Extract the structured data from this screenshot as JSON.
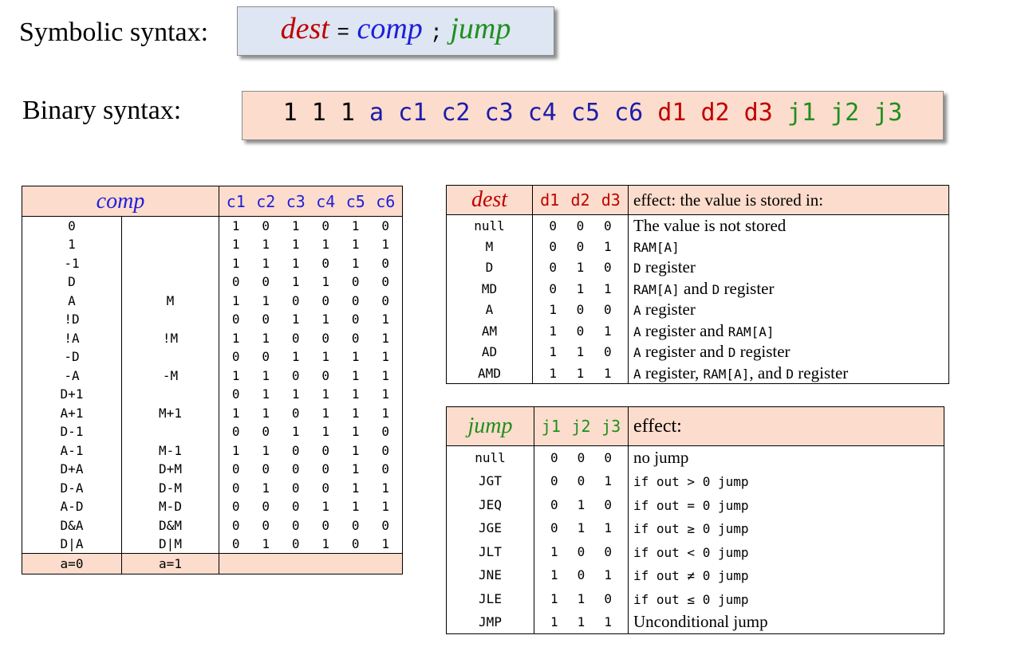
{
  "colors": {
    "dest": "#c00000",
    "comp": "#1f1fdb",
    "jump": "#1f8f1f",
    "a": "#1c1caa",
    "header_bg": "#fcdccc",
    "symbolic_bg": "#dde6f2"
  },
  "symbolic": {
    "label": "Symbolic syntax:",
    "dest": "dest",
    "eq": "=",
    "comp": "comp",
    "semi": ";",
    "jump": "jump"
  },
  "binary": {
    "label": "Binary syntax:",
    "ones": "1 1 1",
    "a": "a",
    "c": "c1 c2 c3 c4 c5 c6",
    "d": "d1 d2 d3",
    "j": "j1 j2 j3"
  },
  "comp_table": {
    "header": "comp",
    "bit_header": [
      "c1",
      "c2",
      "c3",
      "c4",
      "c5",
      "c6"
    ],
    "rows": [
      {
        "a0": "0",
        "a1": "",
        "bits": [
          "1",
          "0",
          "1",
          "0",
          "1",
          "0"
        ]
      },
      {
        "a0": "1",
        "a1": "",
        "bits": [
          "1",
          "1",
          "1",
          "1",
          "1",
          "1"
        ]
      },
      {
        "a0": "-1",
        "a1": "",
        "bits": [
          "1",
          "1",
          "1",
          "0",
          "1",
          "0"
        ]
      },
      {
        "a0": "D",
        "a1": "",
        "bits": [
          "0",
          "0",
          "1",
          "1",
          "0",
          "0"
        ]
      },
      {
        "a0": "A",
        "a1": "M",
        "bits": [
          "1",
          "1",
          "0",
          "0",
          "0",
          "0"
        ]
      },
      {
        "a0": "!D",
        "a1": "",
        "bits": [
          "0",
          "0",
          "1",
          "1",
          "0",
          "1"
        ]
      },
      {
        "a0": "!A",
        "a1": "!M",
        "bits": [
          "1",
          "1",
          "0",
          "0",
          "0",
          "1"
        ]
      },
      {
        "a0": "-D",
        "a1": "",
        "bits": [
          "0",
          "0",
          "1",
          "1",
          "1",
          "1"
        ]
      },
      {
        "a0": "-A",
        "a1": "-M",
        "bits": [
          "1",
          "1",
          "0",
          "0",
          "1",
          "1"
        ]
      },
      {
        "a0": "D+1",
        "a1": "",
        "bits": [
          "0",
          "1",
          "1",
          "1",
          "1",
          "1"
        ]
      },
      {
        "a0": "A+1",
        "a1": "M+1",
        "bits": [
          "1",
          "1",
          "0",
          "1",
          "1",
          "1"
        ]
      },
      {
        "a0": "D-1",
        "a1": "",
        "bits": [
          "0",
          "0",
          "1",
          "1",
          "1",
          "0"
        ]
      },
      {
        "a0": "A-1",
        "a1": "M-1",
        "bits": [
          "1",
          "1",
          "0",
          "0",
          "1",
          "0"
        ]
      },
      {
        "a0": "D+A",
        "a1": "D+M",
        "bits": [
          "0",
          "0",
          "0",
          "0",
          "1",
          "0"
        ]
      },
      {
        "a0": "D-A",
        "a1": "D-M",
        "bits": [
          "0",
          "1",
          "0",
          "0",
          "1",
          "1"
        ]
      },
      {
        "a0": "A-D",
        "a1": "M-D",
        "bits": [
          "0",
          "0",
          "0",
          "1",
          "1",
          "1"
        ]
      },
      {
        "a0": "D&A",
        "a1": "D&M",
        "bits": [
          "0",
          "0",
          "0",
          "0",
          "0",
          "0"
        ]
      },
      {
        "a0": "D|A",
        "a1": "D|M",
        "bits": [
          "0",
          "1",
          "0",
          "1",
          "0",
          "1"
        ]
      }
    ],
    "footer": {
      "a0": "a=0",
      "a1": "a=1"
    }
  },
  "dest_table": {
    "header": "dest",
    "bit_header": [
      "d1",
      "d2",
      "d3"
    ],
    "effect_header": "effect: the value is stored in:",
    "rows": [
      {
        "name": "null",
        "bits": [
          "0",
          "0",
          "0"
        ],
        "effect": [
          {
            "t": "The value is not stored",
            "m": false
          }
        ]
      },
      {
        "name": "M",
        "bits": [
          "0",
          "0",
          "1"
        ],
        "effect": [
          {
            "t": "RAM[A]",
            "m": true
          }
        ]
      },
      {
        "name": "D",
        "bits": [
          "0",
          "1",
          "0"
        ],
        "effect": [
          {
            "t": "D",
            "m": true
          },
          {
            "t": " register",
            "m": false
          }
        ]
      },
      {
        "name": "MD",
        "bits": [
          "0",
          "1",
          "1"
        ],
        "effect": [
          {
            "t": "RAM[A]",
            "m": true
          },
          {
            "t": " and ",
            "m": false
          },
          {
            "t": "D",
            "m": true
          },
          {
            "t": " register",
            "m": false
          }
        ]
      },
      {
        "name": "A",
        "bits": [
          "1",
          "0",
          "0"
        ],
        "effect": [
          {
            "t": "A",
            "m": true
          },
          {
            "t": " register",
            "m": false
          }
        ]
      },
      {
        "name": "AM",
        "bits": [
          "1",
          "0",
          "1"
        ],
        "effect": [
          {
            "t": "A",
            "m": true
          },
          {
            "t": " register and ",
            "m": false
          },
          {
            "t": "RAM[A]",
            "m": true
          }
        ]
      },
      {
        "name": "AD",
        "bits": [
          "1",
          "1",
          "0"
        ],
        "effect": [
          {
            "t": "A",
            "m": true
          },
          {
            "t": " register and ",
            "m": false
          },
          {
            "t": "D",
            "m": true
          },
          {
            "t": " register",
            "m": false
          }
        ]
      },
      {
        "name": "AMD",
        "bits": [
          "1",
          "1",
          "1"
        ],
        "effect": [
          {
            "t": "A",
            "m": true
          },
          {
            "t": " register, ",
            "m": false
          },
          {
            "t": "RAM[A]",
            "m": true
          },
          {
            "t": ", and ",
            "m": false
          },
          {
            "t": "D",
            "m": true
          },
          {
            "t": " register",
            "m": false
          }
        ]
      }
    ]
  },
  "jump_table": {
    "header": "jump",
    "bit_header": [
      "j1",
      "j2",
      "j3"
    ],
    "effect_header": "effect:",
    "rows": [
      {
        "name": "null",
        "bits": [
          "0",
          "0",
          "0"
        ],
        "effect": [
          {
            "t": "no jump",
            "m": false
          }
        ]
      },
      {
        "name": "JGT",
        "bits": [
          "0",
          "0",
          "1"
        ],
        "effect": [
          {
            "t": "if out > 0 jump",
            "m": true
          }
        ]
      },
      {
        "name": "JEQ",
        "bits": [
          "0",
          "1",
          "0"
        ],
        "effect": [
          {
            "t": "if out = 0 jump",
            "m": true
          }
        ]
      },
      {
        "name": "JGE",
        "bits": [
          "0",
          "1",
          "1"
        ],
        "effect": [
          {
            "t": "if out ≥ 0 jump",
            "m": true
          }
        ]
      },
      {
        "name": "JLT",
        "bits": [
          "1",
          "0",
          "0"
        ],
        "effect": [
          {
            "t": "if out < 0 jump",
            "m": true
          }
        ]
      },
      {
        "name": "JNE",
        "bits": [
          "1",
          "0",
          "1"
        ],
        "effect": [
          {
            "t": "if out ≠ 0 jump",
            "m": true
          }
        ]
      },
      {
        "name": "JLE",
        "bits": [
          "1",
          "1",
          "0"
        ],
        "effect": [
          {
            "t": "if out ≤ 0 jump",
            "m": true
          }
        ]
      },
      {
        "name": "JMP",
        "bits": [
          "1",
          "1",
          "1"
        ],
        "effect": [
          {
            "t": "Unconditional jump",
            "m": false
          }
        ]
      }
    ]
  }
}
